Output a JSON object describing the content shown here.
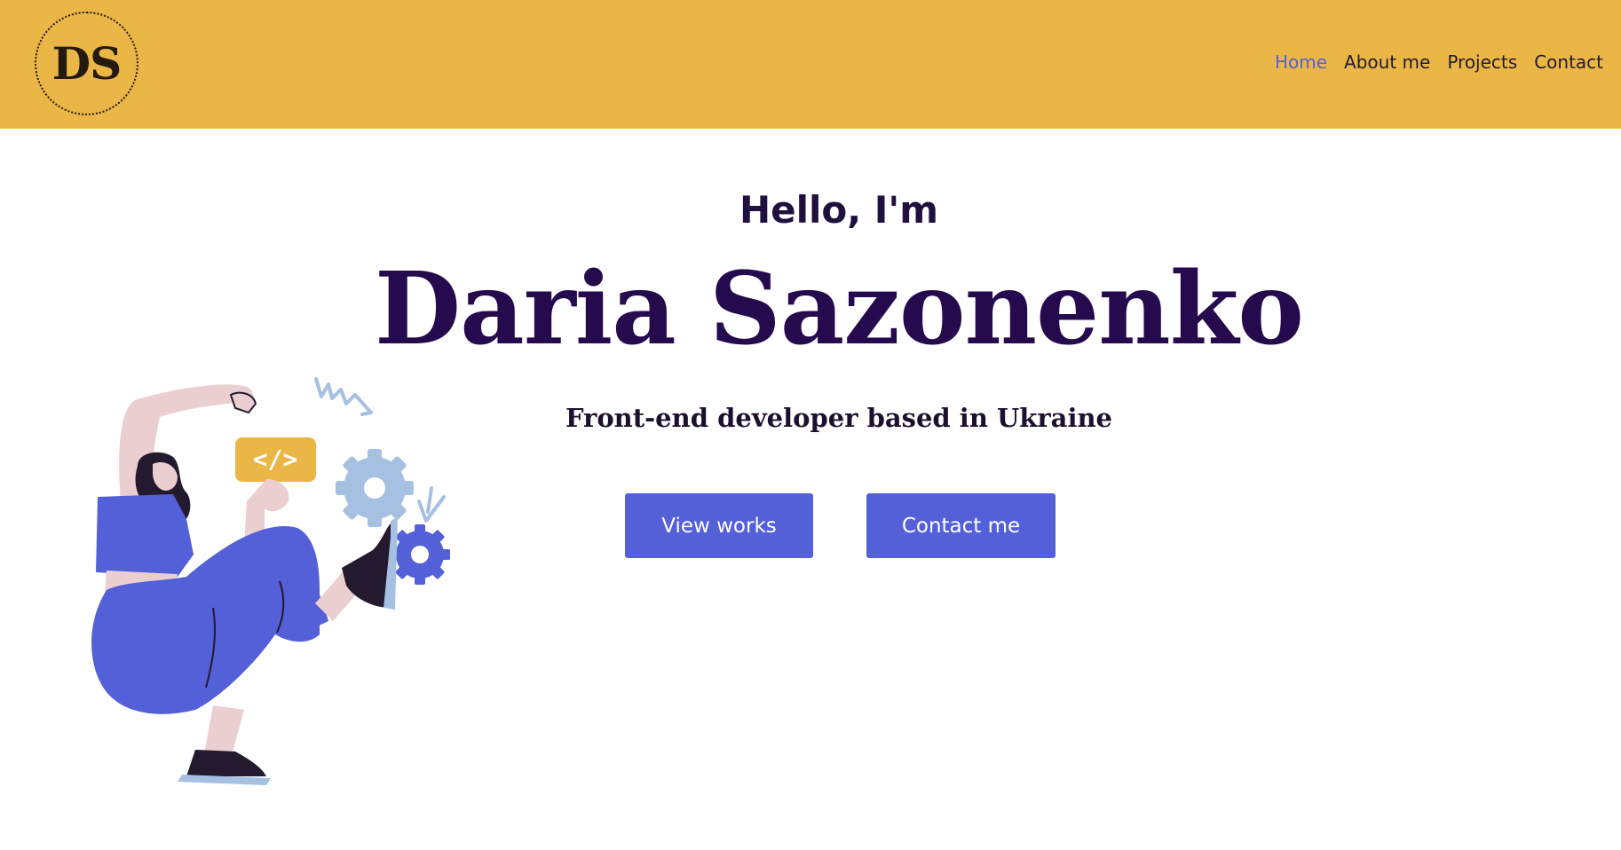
{
  "header": {
    "logo_text": "DS",
    "nav": {
      "home": "Home",
      "about": "About me",
      "projects": "Projects",
      "contact": "Contact"
    }
  },
  "hero": {
    "greeting": "Hello, I'm",
    "name": "Daria Sazonenko",
    "tagline": "Front-end developer based in Ukraine",
    "view_works_label": "View works",
    "contact_me_label": "Contact me"
  },
  "illustration": {
    "code_badge_text": "</>"
  },
  "colors": {
    "header_bg": "#eab646",
    "accent": "#5360d8",
    "nav_active": "#5560d6",
    "heading": "#250a4d"
  }
}
